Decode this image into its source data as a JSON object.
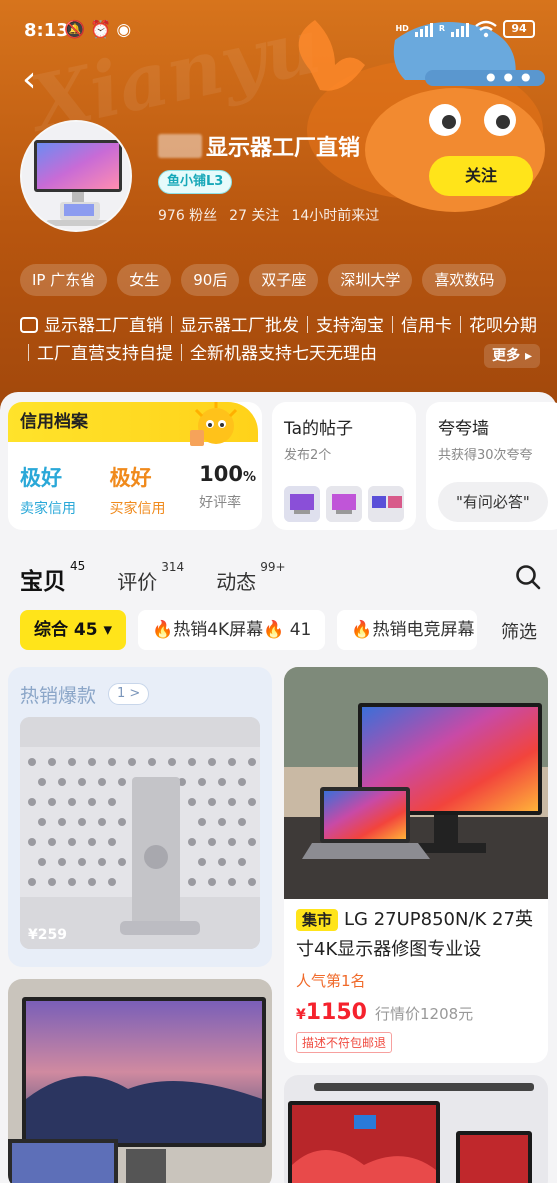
{
  "status_bar": {
    "time": "8:13",
    "signal_label": "HD",
    "signal_label_2": "R",
    "battery": "94"
  },
  "header": {
    "shop_name": "显示器工厂直销",
    "level": "鱼小铺L3",
    "fans": "976 粉丝",
    "following": "27 关注",
    "last_seen": "14小时前来过",
    "follow_label": "关注",
    "tags": [
      "IP 广东省",
      "女生",
      "90后",
      "双子座",
      "深圳大学",
      "喜欢数码"
    ],
    "bio": "显示器工厂直销｜显示器工厂批发｜支持淘宝｜信用卡｜花呗分期｜工厂直营支持自提｜全新机器支持七天无理由",
    "more_label": "更多"
  },
  "credit": {
    "title": "信用档案",
    "seller_value": "极好",
    "seller_label": "卖家信用",
    "buyer_value": "极好",
    "buyer_label": "买家信用",
    "rate_value": "100",
    "rate_unit": "%",
    "rate_label": "好评率",
    "colors": {
      "seller": "#2aa8d8",
      "buyer": "#f08a1c"
    }
  },
  "posts": {
    "title": "Ta的帖子",
    "subtitle": "发布2个"
  },
  "wall": {
    "title": "夸夸墙",
    "subtitle": "共获得30次夸夸",
    "qa": "\"有问必答\""
  },
  "tabs": [
    {
      "label": "宝贝",
      "count": "45"
    },
    {
      "label": "评价",
      "count": "314"
    },
    {
      "label": "动态",
      "count": "99+"
    }
  ],
  "filters": {
    "sort": "综合 45",
    "chip1": "🔥热销4K屏幕🔥 41",
    "chip2": "🔥热销电竞屏幕",
    "filter": "筛选"
  },
  "hot": {
    "title": "热销爆款",
    "count": "1 >",
    "price": "¥259"
  },
  "product": {
    "tag": "集市",
    "title": "LG 27UP850N/K 27英寸4K显示器修图专业设",
    "popularity": "人气第1名",
    "price_symbol": "¥",
    "price": "1150",
    "ref_price": "行情价1208元",
    "badge": "描述不符包邮退"
  }
}
